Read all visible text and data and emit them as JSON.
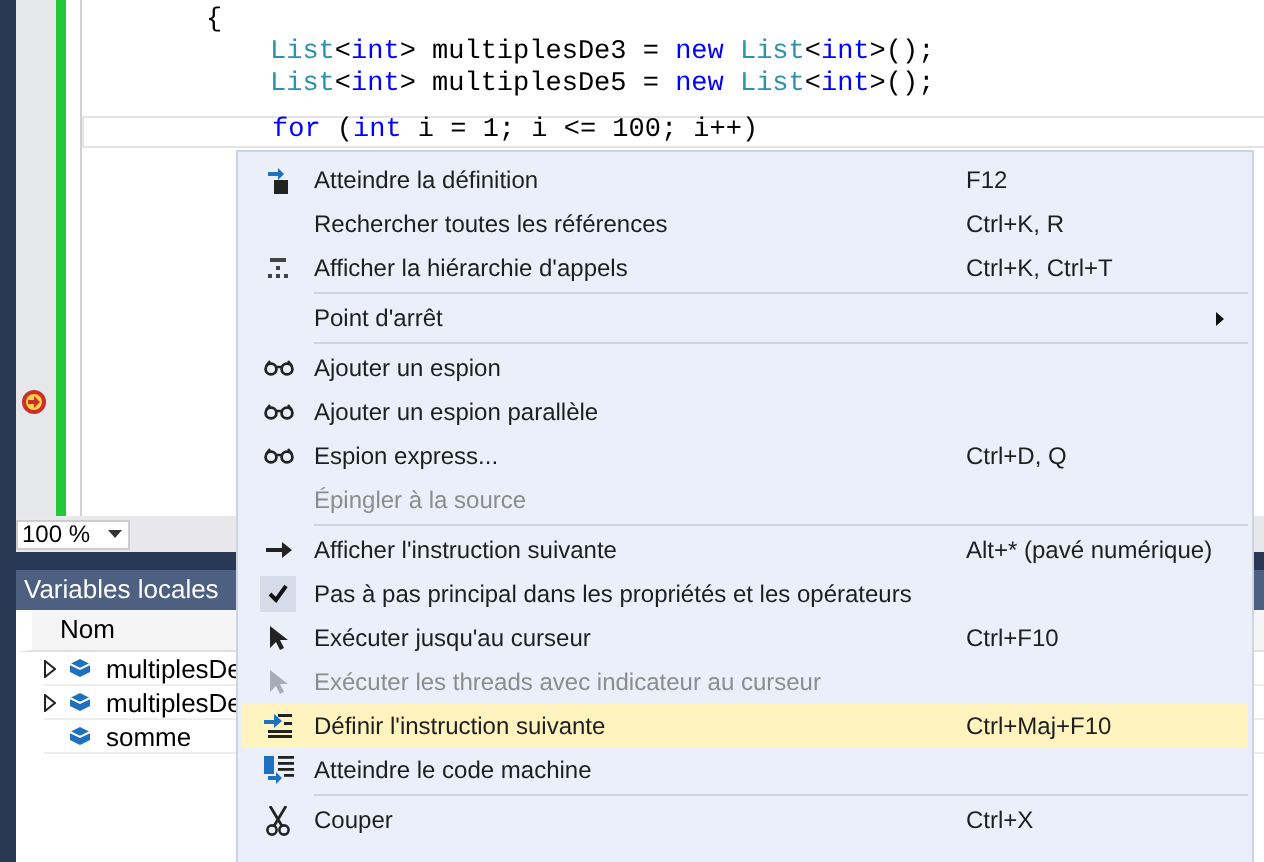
{
  "editor": {
    "lines": [
      {
        "tokens": [
          {
            "kind": "plain",
            "text": "{"
          }
        ],
        "children": [
          {
            "tokens": [
              {
                "kind": "type",
                "text": "List"
              },
              {
                "kind": "plain",
                "text": "<"
              },
              {
                "kind": "keyword",
                "text": "int"
              },
              {
                "kind": "plain",
                "text": "> multiplesDe3 = "
              },
              {
                "kind": "keyword",
                "text": "new "
              },
              {
                "kind": "type",
                "text": "List"
              },
              {
                "kind": "plain",
                "text": "<"
              },
              {
                "kind": "keyword",
                "text": "int"
              },
              {
                "kind": "plain",
                "text": ">();"
              }
            ],
            "current": false
          },
          {
            "tokens": [
              {
                "kind": "type",
                "text": "List"
              },
              {
                "kind": "plain",
                "text": "<"
              },
              {
                "kind": "keyword",
                "text": "int"
              },
              {
                "kind": "plain",
                "text": "> multiplesDe5 = "
              },
              {
                "kind": "keyword",
                "text": "new "
              },
              {
                "kind": "type",
                "text": "List"
              },
              {
                "kind": "plain",
                "text": "<"
              },
              {
                "kind": "keyword",
                "text": "int"
              },
              {
                "kind": "plain",
                "text": ">();"
              }
            ],
            "current": false
          },
          {
            "tokens": [
              {
                "kind": "keyword",
                "text": "for"
              },
              {
                "kind": "plain",
                "text": " ("
              },
              {
                "kind": "keyword",
                "text": "int"
              },
              {
                "kind": "plain",
                "text": " i = 1; i <= 100; i++)"
              }
            ],
            "current": true
          }
        ]
      }
    ],
    "zoom": "100 %"
  },
  "locals": {
    "title": "Variables locales",
    "column": "Nom",
    "rows": [
      {
        "name": "multiplesDe",
        "expandable": true
      },
      {
        "name": "multiplesDe",
        "expandable": true
      },
      {
        "name": "somme",
        "expandable": false
      }
    ]
  },
  "context_menu": [
    {
      "kind": "item",
      "label": "Atteindre la définition",
      "shortcut": "F12",
      "disabled": false,
      "selected": false,
      "checked": false
    },
    {
      "kind": "item",
      "label": "Rechercher toutes les références",
      "shortcut": "Ctrl+K, R",
      "disabled": false,
      "selected": false,
      "checked": false
    },
    {
      "kind": "item",
      "label": "Afficher la hiérarchie d'appels",
      "shortcut": "Ctrl+K, Ctrl+T",
      "disabled": false,
      "selected": false,
      "checked": false
    },
    {
      "kind": "separator"
    },
    {
      "kind": "submenu",
      "label": "Point d'arrêt",
      "disabled": false,
      "selected": false,
      "checked": false
    },
    {
      "kind": "separator"
    },
    {
      "kind": "item",
      "label": "Ajouter un espion",
      "disabled": false,
      "selected": false,
      "checked": false
    },
    {
      "kind": "item",
      "label": "Ajouter un espion parallèle",
      "disabled": false,
      "selected": false,
      "checked": false
    },
    {
      "kind": "item",
      "label": "Espion express...",
      "shortcut": "Ctrl+D, Q",
      "disabled": false,
      "selected": false,
      "checked": false
    },
    {
      "kind": "item",
      "label": "Épingler à la source",
      "disabled": true,
      "selected": false,
      "checked": false
    },
    {
      "kind": "separator"
    },
    {
      "kind": "item",
      "label": "Afficher l'instruction suivante",
      "shortcut": "Alt+* (pavé numérique)",
      "disabled": false,
      "selected": false,
      "checked": false
    },
    {
      "kind": "item",
      "label": "Pas à pas principal dans les propriétés et les opérateurs",
      "disabled": false,
      "selected": false,
      "checked": true
    },
    {
      "kind": "item",
      "label": "Exécuter jusqu'au curseur",
      "shortcut": "Ctrl+F10",
      "disabled": false,
      "selected": false,
      "checked": false
    },
    {
      "kind": "item",
      "label": "Exécuter les threads avec indicateur au curseur",
      "disabled": true,
      "selected": false,
      "checked": false
    },
    {
      "kind": "item",
      "label": "Définir l'instruction suivante",
      "shortcut": "Ctrl+Maj+F10",
      "disabled": false,
      "selected": true,
      "checked": false
    },
    {
      "kind": "item",
      "label": "Atteindre le code machine",
      "disabled": false,
      "selected": false,
      "checked": false
    },
    {
      "kind": "separator"
    },
    {
      "kind": "item",
      "label": "Couper",
      "shortcut": "Ctrl+X",
      "disabled": false,
      "selected": false,
      "checked": false
    }
  ]
}
